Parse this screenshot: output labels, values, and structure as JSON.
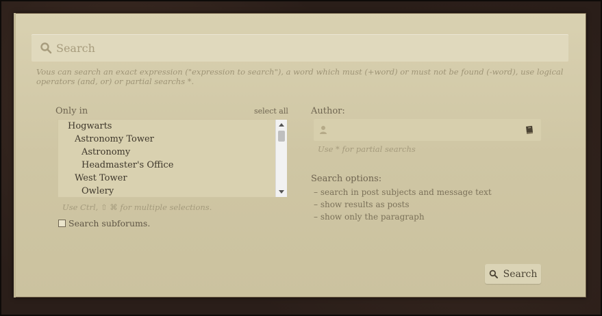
{
  "search": {
    "placeholder": "Search",
    "hint": "Vous can search an exact expression (\"expression to search\"), a word which must (+word) or must not be found (-word), use logical operators (and, or) or partial searchs *."
  },
  "forums": {
    "label": "Only in",
    "select_all": "select all",
    "items": [
      {
        "label": "Hogwarts"
      },
      {
        "label": "Astronomy Tower"
      },
      {
        "label": "Astronomy"
      },
      {
        "label": "Headmaster's Office"
      },
      {
        "label": "West Tower"
      },
      {
        "label": "Owlery"
      }
    ],
    "multi_hint": "Use Ctrl, ⇧ ⌘ for multiple selections.",
    "subforums_label": "Search subforums."
  },
  "author": {
    "label": "Author:",
    "value": "",
    "hint": "Use * for partial searchs"
  },
  "options": {
    "label": "Search options:",
    "items": [
      "– search in post subjects and message text",
      "– show results as posts",
      "– show only the paragraph"
    ]
  },
  "submit": {
    "label": "Search"
  },
  "icons": [
    "search-icon",
    "user-icon",
    "book-icon",
    "checkbox-icon"
  ]
}
